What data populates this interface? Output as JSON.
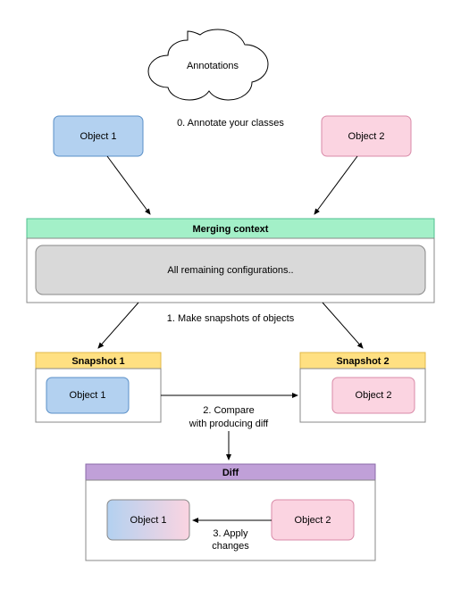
{
  "annotations": {
    "label": "Annotations"
  },
  "objects": {
    "obj1": {
      "label": "Object 1",
      "fill": "#b3d1f0",
      "stroke": "#5a8fc7"
    },
    "obj2": {
      "label": "Object 2",
      "fill": "#fbd4e1",
      "stroke": "#d98aa8"
    }
  },
  "steps": {
    "s0": "0. Annotate your classes",
    "s1": "1. Make snapshots of objects",
    "s2a": "2. Compare",
    "s2b": "with producing diff",
    "s3a": "3. Apply",
    "s3b": "changes"
  },
  "merging_context": {
    "title": "Merging context",
    "body": "All remaining configurations..",
    "title_fill": "#a3f0c8",
    "title_stroke": "#4fbf8f"
  },
  "snapshots": {
    "s1": {
      "title": "Snapshot 1",
      "obj": "Object 1"
    },
    "s2": {
      "title": "Snapshot 2",
      "obj": "Object 2"
    },
    "title_fill": "#ffe082",
    "title_stroke": "#e0b84a"
  },
  "diff": {
    "title": "Diff",
    "obj1": "Object 1",
    "obj2": "Object 2",
    "title_fill": "#c0a0d8",
    "title_stroke": "#8a6aa8",
    "gradient_from": "#b3d1f0",
    "gradient_to": "#fbd4e1"
  }
}
